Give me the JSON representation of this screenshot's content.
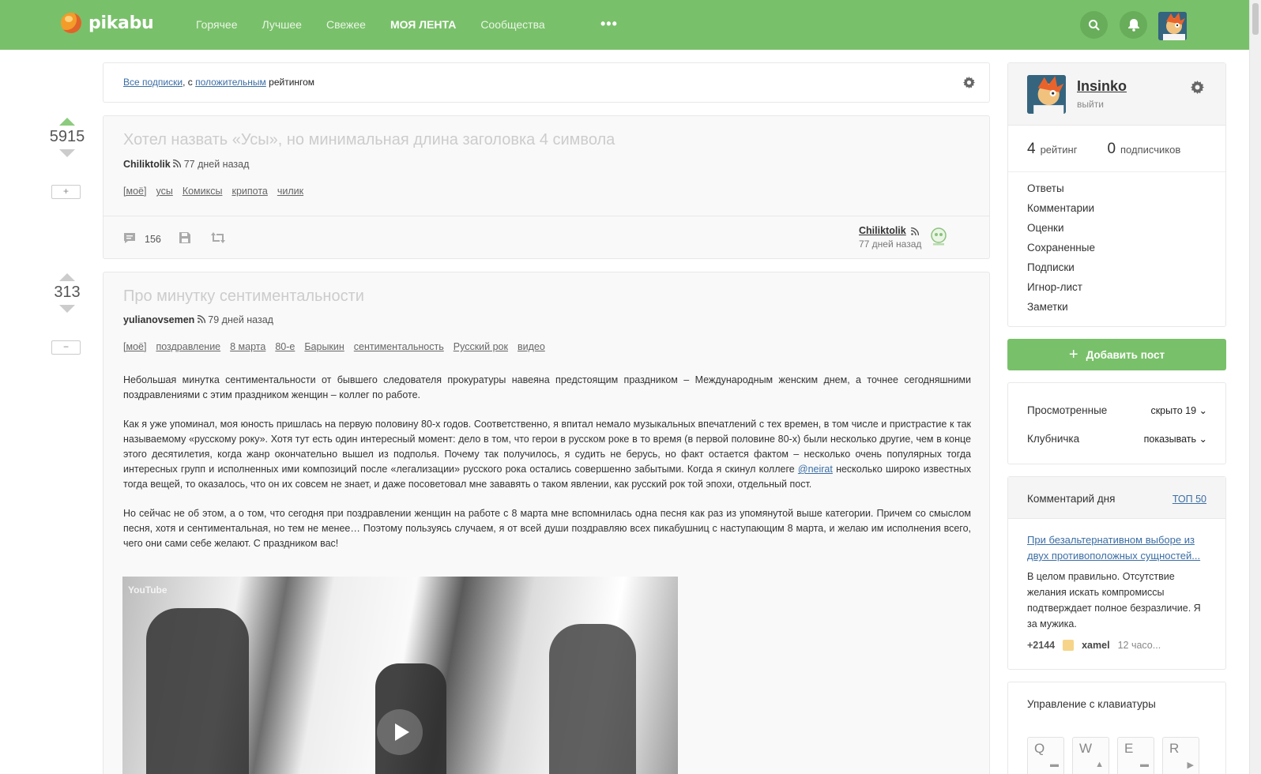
{
  "header": {
    "logo_text": "pikabu",
    "nav": [
      "Горячее",
      "Лучшее",
      "Свежее",
      "МОЯ ЛЕНТА",
      "Сообщества"
    ],
    "more": "•••",
    "brand_color": "#79c06a"
  },
  "filter": {
    "all_subs": "Все подписки",
    "sep": ", с ",
    "positive": "положительным",
    "rating_word": " рейтингом"
  },
  "stories": [
    {
      "rating": "5915",
      "title": "Хотел назвать «Усы», но минимальная длина заголовка 4 символа",
      "author": "Chiliktolik",
      "time": "77 дней назад",
      "tags": [
        "[моё]",
        "усы",
        "Комиксы",
        "крипота",
        "чилик"
      ],
      "comments": "156",
      "footer_author": "Chiliktolik",
      "footer_time": "77 дней назад"
    },
    {
      "rating": "313",
      "title": "Про минутку сентиментальности",
      "author": "yulianovsemen",
      "time": "79 дней назад",
      "tags": [
        "[моё]",
        "поздравление",
        "8 марта",
        "80-е",
        "Барыкин",
        "сентиментальность",
        "Русский рок",
        "видео"
      ],
      "p1": "Небольшая минутка сентиментальности от бывшего следователя прокуратуры навеяна предстоящим праздником – Международным женским днем, а точнее сегодняшними поздравлениями с этим праздником женщин – коллег по работе.",
      "p2_a": "Как я уже упоминал, моя юность пришлась на первую половину 80-х годов. Соответственно, я впитал немало музыкальных впечатлений с тех времен, в том числе и пристрастие к так называемому «русскому року». Хотя тут есть один интересный момент: дело в том, что герои в русском роке в то время (в первой половине 80-х) были несколько другие, чем в конце этого десятилетия, когда жанр окончательно вышел из подполья. Почему так получилось, я судить не берусь, но факт остается фактом – несколько очень популярных тогда интересных групп и исполненных ими композиций после «легализации» русского рока остались совершенно забытыми. Когда я скинул коллеге ",
      "p2_link": "@neirat",
      "p2_b": " несколько широко известных тогда вещей, то оказалось, что он их совсем не знает, и даже посоветовал мне зававять о таком явлении, как русский рок той эпохи, отдельный пост.",
      "p3": "Но сейчас не об этом, а о том, что сегодня при поздравлении женщин на работе с 8 марта мне вспомнилась одна песня как раз из упомянутой выше категории. Причем со смыслом песня, хотя и сентиментальная, но тем не менее… Поэтому пользуясь случаем, я от всей души поздравляю всех пикабушниц с наступающим 8 марта, и желаю им исполнения всего, чего они сами себе желают. С праздником вас!",
      "video_label": "YouTube"
    }
  ],
  "sidebar": {
    "username": "Insinko",
    "logout": "выйти",
    "rating_num": "4",
    "rating_label": "рейтинг",
    "subs_num": "0",
    "subs_label": "подписчиков",
    "menu": [
      "Ответы",
      "Комментарии",
      "Оценки",
      "Сохраненные",
      "Подписки",
      "Игнор-лист",
      "Заметки"
    ],
    "add_post": "Добавить пост",
    "viewed_label": "Просмотренные",
    "viewed_value": "скрыто 19",
    "strawberry_label": "Клубничка",
    "strawberry_value": "показывать",
    "comment_day": {
      "title": "Комментарий дня",
      "top": "ТОП 50",
      "link": "При безальтернативном выборе из двух противоположных сущностей...",
      "body": "В целом правильно. Отсутствие желания искать компромиссы подтверждает полное безразличие. Я за мужика.",
      "rating": "+2144",
      "user": "xamel",
      "time": "12 часо..."
    },
    "keyboard": {
      "title": "Управление с клавиатуры",
      "keys": [
        "Q",
        "W",
        "E",
        "R"
      ]
    }
  }
}
